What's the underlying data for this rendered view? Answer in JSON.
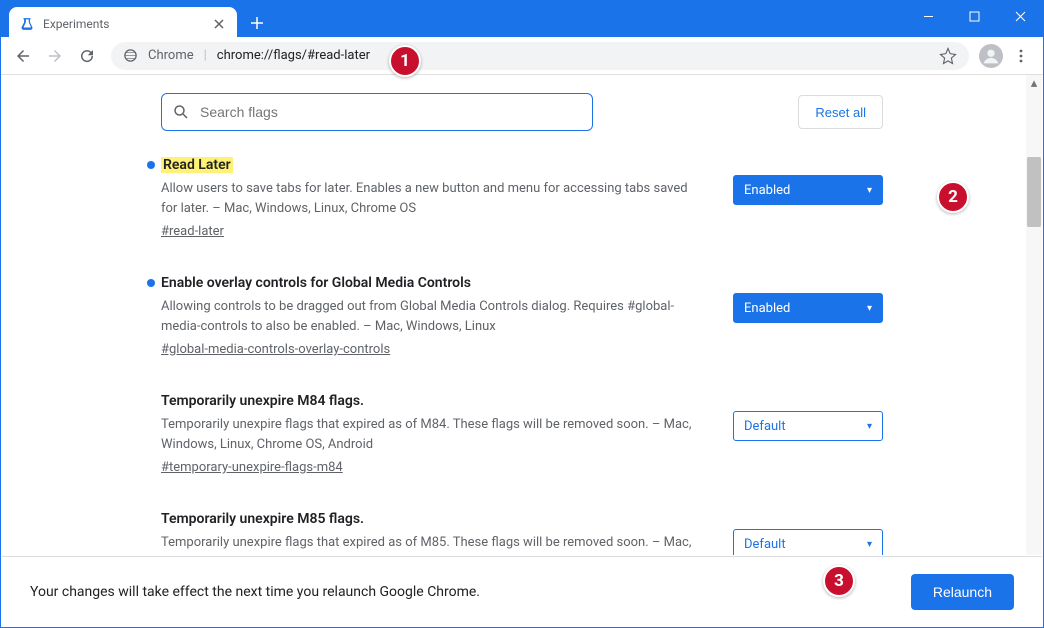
{
  "tab": {
    "title": "Experiments"
  },
  "omnibox": {
    "label": "Chrome",
    "url": "chrome://flags/#read-later"
  },
  "search": {
    "placeholder": "Search flags"
  },
  "reset_label": "Reset all",
  "flags": [
    {
      "title": "Read Later",
      "highlighted": true,
      "bullet": true,
      "description": "Allow users to save tabs for later. Enables a new button and menu for accessing tabs saved for later. – Mac, Windows, Linux, Chrome OS",
      "anchor": "#read-later",
      "value": "Enabled",
      "style": "filled"
    },
    {
      "title": "Enable overlay controls for Global Media Controls",
      "highlighted": false,
      "bullet": true,
      "description": "Allowing controls to be dragged out from Global Media Controls dialog. Requires #global-media-controls to also be enabled. – Mac, Windows, Linux",
      "anchor": "#global-media-controls-overlay-controls",
      "value": "Enabled",
      "style": "filled"
    },
    {
      "title": "Temporarily unexpire M84 flags.",
      "highlighted": false,
      "bullet": false,
      "description": "Temporarily unexpire flags that expired as of M84. These flags will be removed soon. – Mac, Windows, Linux, Chrome OS, Android",
      "anchor": "#temporary-unexpire-flags-m84",
      "value": "Default",
      "style": "outlined"
    },
    {
      "title": "Temporarily unexpire M85 flags.",
      "highlighted": false,
      "bullet": false,
      "description": "Temporarily unexpire flags that expired as of M85. These flags will be removed soon. – Mac,",
      "anchor": "",
      "value": "Default",
      "style": "outlined"
    }
  ],
  "bottom_text": "Your changes will take effect the next time you relaunch Google Chrome.",
  "relaunch_label": "Relaunch",
  "badges": {
    "b1": "1",
    "b2": "2",
    "b3": "3"
  }
}
